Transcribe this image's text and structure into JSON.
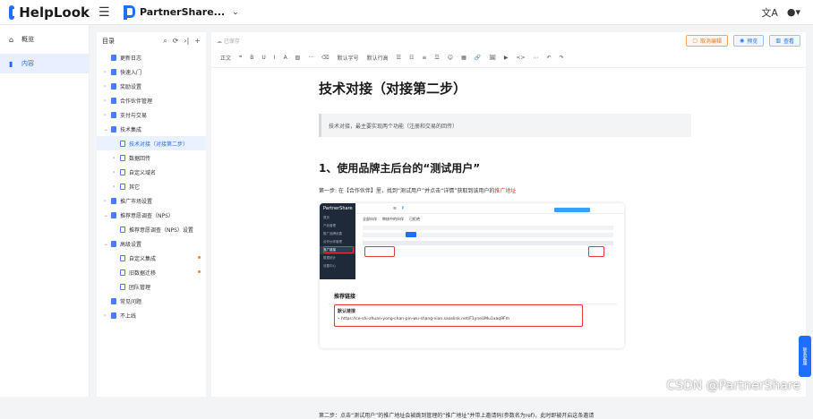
{
  "brand": {
    "name": "HelpLook"
  },
  "project": {
    "name": "PartnerShare..."
  },
  "leftnav": [
    {
      "label": "概览",
      "icon": "home-icon"
    },
    {
      "label": "内容",
      "icon": "book-icon"
    }
  ],
  "tree": {
    "title": "目录",
    "items": [
      {
        "label": "更新日志",
        "level": 0,
        "arrow": ""
      },
      {
        "label": "快速入门",
        "level": 0,
        "arrow": "›"
      },
      {
        "label": "奖励设置",
        "level": 0,
        "arrow": "›"
      },
      {
        "label": "合作伙伴管理",
        "level": 0,
        "arrow": "›"
      },
      {
        "label": "支付与交易",
        "level": 0,
        "arrow": "›"
      },
      {
        "label": "技术集成",
        "level": 0,
        "arrow": "⌄"
      },
      {
        "label": "技术对接（对接第二步）",
        "level": 1,
        "arrow": ""
      },
      {
        "label": "数据回传",
        "level": 1,
        "arrow": "›"
      },
      {
        "label": "自定义域名",
        "level": 1,
        "arrow": "›"
      },
      {
        "label": "其它",
        "level": 1,
        "arrow": "›"
      },
      {
        "label": "推广市场设置",
        "level": 0,
        "arrow": "›"
      },
      {
        "label": "推荐意愿调查（NPS）",
        "level": 0,
        "arrow": "⌄"
      },
      {
        "label": "推荐意愿调查（NPS）设置",
        "level": 1,
        "arrow": ""
      },
      {
        "label": "高级设置",
        "level": 0,
        "arrow": "⌄"
      },
      {
        "label": "自定义集成",
        "level": 1,
        "arrow": ""
      },
      {
        "label": "旧数据迁移",
        "level": 1,
        "arrow": ""
      },
      {
        "label": "团队管理",
        "level": 1,
        "arrow": ""
      },
      {
        "label": "常见问题",
        "level": 0,
        "arrow": ""
      },
      {
        "label": "不上线",
        "level": 0,
        "arrow": "›"
      }
    ]
  },
  "editor": {
    "saved": "已保存",
    "btn_exit": "取消编辑",
    "btn_preview": "预览",
    "btn_view": "查看",
    "toolbar": [
      "正文",
      "❝",
      "B",
      "U",
      "I",
      "A",
      "▨",
      "···",
      "⌫",
      "默认字号",
      "默认行高",
      "☰",
      "☷",
      "≡",
      "☲",
      "☺",
      "▦",
      "🔗",
      "🖼",
      "▶",
      "<>",
      "⋯",
      "↶",
      "↷"
    ]
  },
  "doc": {
    "title": "技术对接（对接第二步）",
    "quote": "技术对接，最主要实现两个功能（注册和交易的回传）",
    "h2": "1、使用品牌主后台的“测试用户”",
    "para1": "第一步: 在【合作伙伴】里，找到“测试用户”并点击“详情”获取到该用户的",
    "para1_red": "推广地址",
    "para2": "第二步：点击“测试用户”的推广地址会被跳到管理的“推广地址”并带上邀请码(参数名为ref)，此时即被开启这条邀请"
  },
  "shot": {
    "sidebar_title": "PartnerShare",
    "sidebar_items": [
      "首页",
      "产品管理",
      "推广品牌设置",
      "合作伙伴管理",
      "推广链接",
      "数据统计",
      "设置中心"
    ],
    "tabs": [
      "全部伙伴",
      "审核中的伙伴",
      "已拒绝"
    ],
    "panel_title": "推荐链接",
    "panel_label": "默认链接",
    "panel_url": "https://ce-shi-zhuan-yong-chan-pin-wu-shang-xian.saaslink.net/F1yneUMu1xaq9Fm"
  },
  "watermark": "CSDN @PartnerShare",
  "float_btn": "联系客服"
}
